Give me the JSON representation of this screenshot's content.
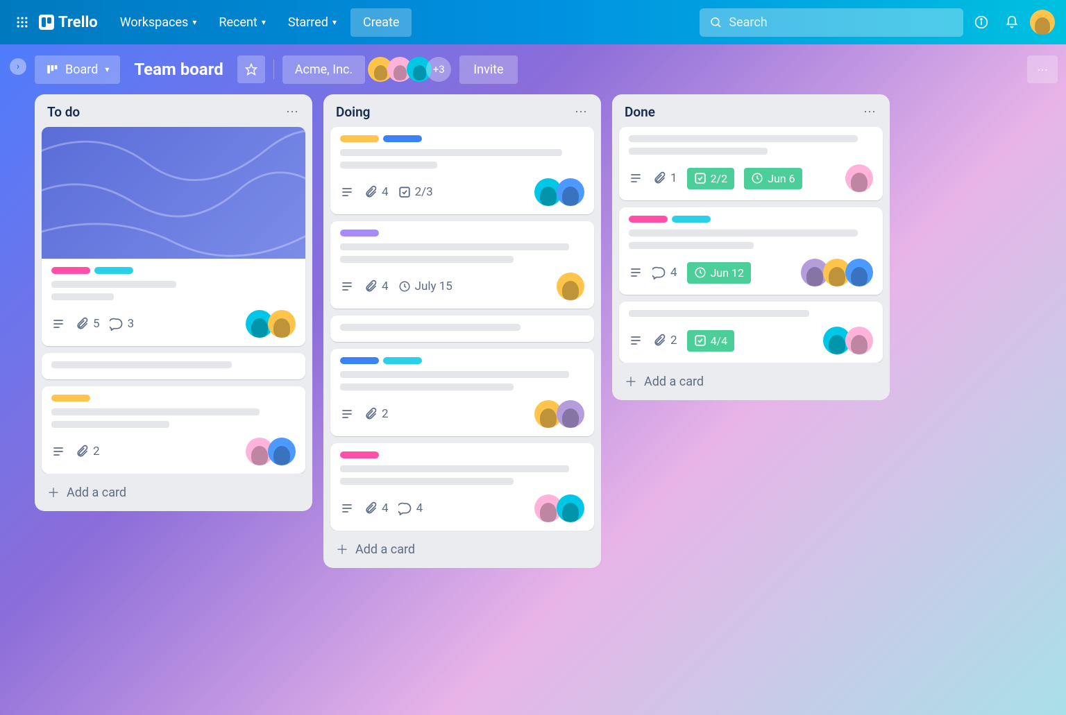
{
  "nav": {
    "brand": "Trello",
    "workspaces": "Workspaces",
    "recent": "Recent",
    "starred": "Starred",
    "create": "Create",
    "search_placeholder": "Search"
  },
  "boardBar": {
    "viewLabel": "Board",
    "title": "Team board",
    "workspace": "Acme, Inc.",
    "extraMembers": "+3",
    "invite": "Invite"
  },
  "lists": [
    {
      "title": "To do",
      "addCard": "Add a card",
      "cards": [
        {
          "cover": true,
          "labels": [
            "#ff4fa7",
            "#29d0e7"
          ],
          "lines": [
            180,
            90
          ],
          "badges": {
            "desc": true,
            "attachments": "5",
            "comments": "3"
          },
          "members": [
            "av-teal",
            "av-yellow"
          ]
        },
        {
          "labels": [],
          "lines": [
            260
          ],
          "badges": {},
          "members": []
        },
        {
          "labels": [
            "#ffc44c"
          ],
          "lines": [
            300,
            170
          ],
          "badges": {
            "desc": true,
            "attachments": "2"
          },
          "members": [
            "av-pink",
            "av-blue"
          ]
        }
      ]
    },
    {
      "title": "Doing",
      "addCard": "Add a card",
      "cards": [
        {
          "labels": [
            "#ffc44c",
            "#3b82f6"
          ],
          "lines": [
            320,
            140
          ],
          "badges": {
            "desc": true,
            "checklist": "2/3",
            "attachments": "4"
          },
          "members": [
            "av-teal",
            "av-blue"
          ]
        },
        {
          "labels": [
            "#a78bfa"
          ],
          "lines": [
            330,
            250
          ],
          "badges": {
            "desc": true,
            "attachments": "4",
            "due": "July 15"
          },
          "members": [
            "av-yellow"
          ]
        },
        {
          "labels": [],
          "lines": [
            260
          ],
          "badges": {},
          "members": []
        },
        {
          "labels": [
            "#3b82f6",
            "#29d0e7"
          ],
          "lines": [
            330,
            250
          ],
          "badges": {
            "desc": true,
            "attachments": "2"
          },
          "members": [
            "av-yellow",
            "av-purple"
          ]
        },
        {
          "labels": [
            "#ff4fa7"
          ],
          "lines": [
            330,
            250
          ],
          "badges": {
            "desc": true,
            "attachments": "4",
            "comments": "4"
          },
          "members": [
            "av-pink",
            "av-teal"
          ]
        }
      ]
    },
    {
      "title": "Done",
      "addCard": "Add a card",
      "cards": [
        {
          "labels": [],
          "lines": [
            330,
            200
          ],
          "badges": {
            "desc": true,
            "attachments": "1",
            "checklist_done": "2/2",
            "due_done": "Jun 6"
          },
          "members": [
            "av-pink"
          ]
        },
        {
          "labels": [
            "#ff4fa7",
            "#29d0e7"
          ],
          "lines": [
            330,
            180
          ],
          "badges": {
            "desc": true,
            "comments": "4",
            "due_done": "Jun 12"
          },
          "members": [
            "av-purple",
            "av-yellow",
            "av-blue"
          ]
        },
        {
          "labels": [],
          "lines": [
            260
          ],
          "badges": {
            "desc": true,
            "attachments": "2",
            "checklist_done": "4/4"
          },
          "members": [
            "av-teal",
            "av-pink"
          ]
        }
      ]
    }
  ]
}
